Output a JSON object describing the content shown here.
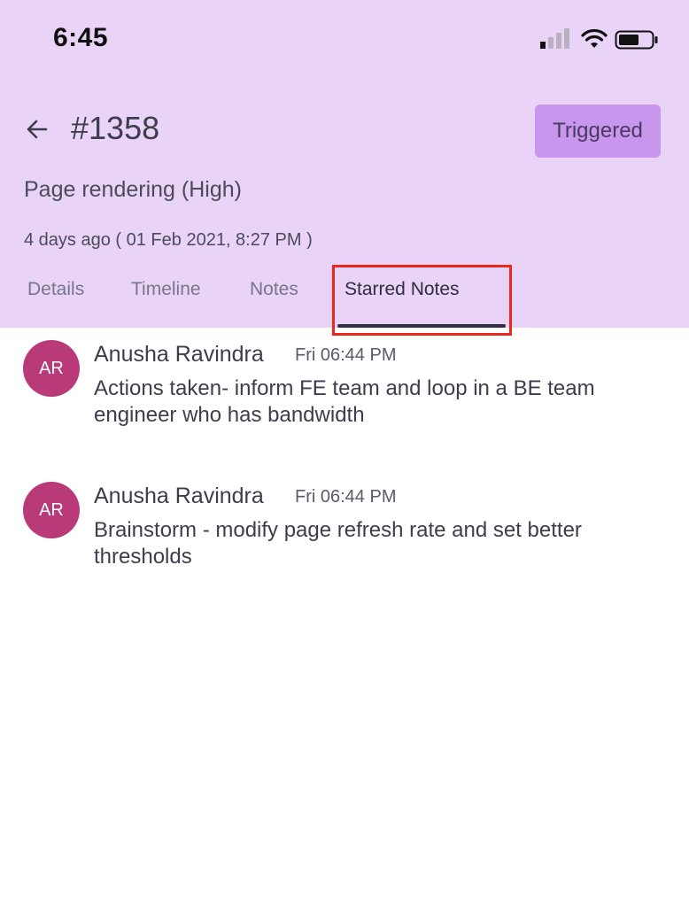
{
  "status_bar": {
    "time": "6:45",
    "signal_icon": "cellular-signal-icon",
    "wifi_icon": "wifi-icon",
    "battery_icon": "battery-icon"
  },
  "header": {
    "back_icon": "back-arrow-icon",
    "incident_id": "#1358",
    "status_label": "Triggered",
    "title": "Page rendering (High)",
    "time": "4 days ago ( 01 Feb 2021, 8:27 PM )"
  },
  "tabs": [
    {
      "label": "Details",
      "active": false
    },
    {
      "label": "Timeline",
      "active": false
    },
    {
      "label": "Notes",
      "active": false
    },
    {
      "label": "Starred Notes",
      "active": true
    }
  ],
  "notes": [
    {
      "initials": "AR",
      "author": "Anusha Ravindra",
      "time": "Fri 06:44 PM",
      "text": "Actions taken- inform FE team and loop in a BE team engineer who has bandwidth"
    },
    {
      "initials": "AR",
      "author": "Anusha Ravindra",
      "time": "Fri 06:44 PM",
      "text": "Brainstorm - modify page refresh rate and set better thresholds"
    }
  ],
  "colors": {
    "header_bg": "#e9d3f6",
    "status_button_bg": "#c896ec",
    "avatar_bg": "#b93a78",
    "highlight": "#e8291b"
  }
}
